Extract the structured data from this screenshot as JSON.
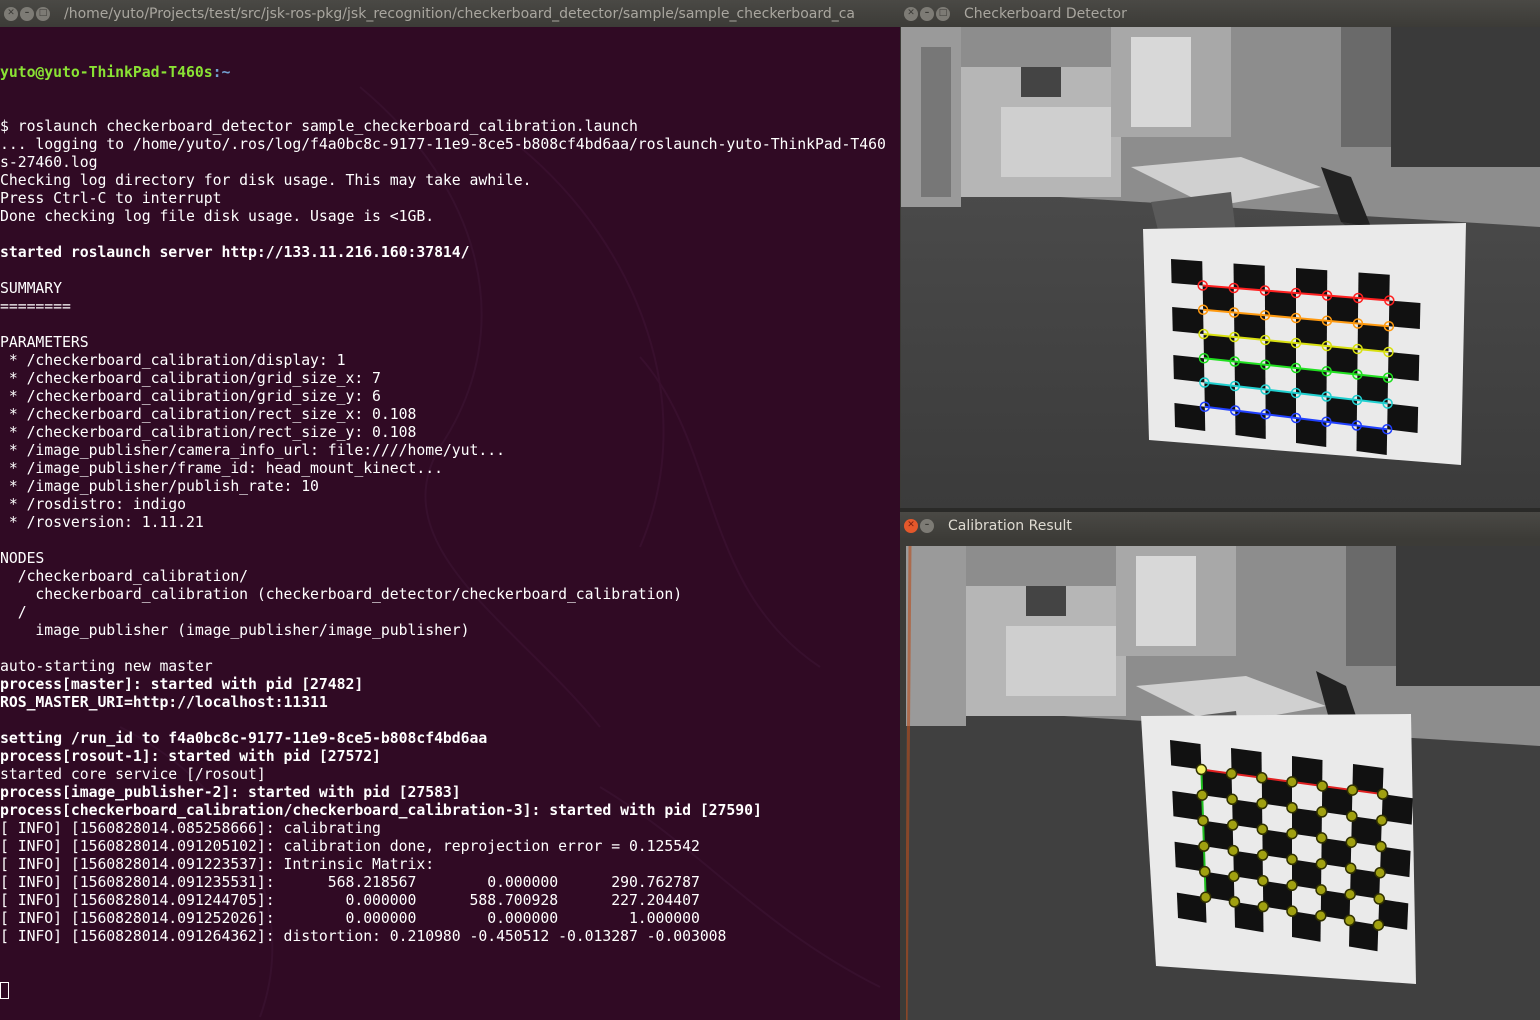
{
  "terminal": {
    "title": "/home/yuto/Projects/test/src/jsk-ros-pkg/jsk_recognition/checkerboard_detector/sample/sample_checkerboard_ca",
    "prompt_user": "yuto@yuto-ThinkPad-T460s",
    "prompt_path": ":~",
    "lines": [
      {
        "text": "$ roslaunch checkerboard_detector sample_checkerboard_calibration.launch",
        "bold": false
      },
      {
        "text": "... logging to /home/yuto/.ros/log/f4a0bc8c-9177-11e9-8ce5-b808cf4bd6aa/roslaunch-yuto-ThinkPad-T460",
        "bold": false
      },
      {
        "text": "s-27460.log",
        "bold": false
      },
      {
        "text": "Checking log directory for disk usage. This may take awhile.",
        "bold": false
      },
      {
        "text": "Press Ctrl-C to interrupt",
        "bold": false
      },
      {
        "text": "Done checking log file disk usage. Usage is <1GB.",
        "bold": false
      },
      {
        "text": "",
        "bold": false
      },
      {
        "text": "started roslaunch server http://133.11.216.160:37814/",
        "bold": true
      },
      {
        "text": "",
        "bold": false
      },
      {
        "text": "SUMMARY",
        "bold": false
      },
      {
        "text": "========",
        "bold": false
      },
      {
        "text": "",
        "bold": false
      },
      {
        "text": "PARAMETERS",
        "bold": false
      },
      {
        "text": " * /checkerboard_calibration/display: 1",
        "bold": false
      },
      {
        "text": " * /checkerboard_calibration/grid_size_x: 7",
        "bold": false
      },
      {
        "text": " * /checkerboard_calibration/grid_size_y: 6",
        "bold": false
      },
      {
        "text": " * /checkerboard_calibration/rect_size_x: 0.108",
        "bold": false
      },
      {
        "text": " * /checkerboard_calibration/rect_size_y: 0.108",
        "bold": false
      },
      {
        "text": " * /image_publisher/camera_info_url: file:////home/yut...",
        "bold": false
      },
      {
        "text": " * /image_publisher/frame_id: head_mount_kinect...",
        "bold": false
      },
      {
        "text": " * /image_publisher/publish_rate: 10",
        "bold": false
      },
      {
        "text": " * /rosdistro: indigo",
        "bold": false
      },
      {
        "text": " * /rosversion: 1.11.21",
        "bold": false
      },
      {
        "text": "",
        "bold": false
      },
      {
        "text": "NODES",
        "bold": false
      },
      {
        "text": "  /checkerboard_calibration/",
        "bold": false
      },
      {
        "text": "    checkerboard_calibration (checkerboard_detector/checkerboard_calibration)",
        "bold": false
      },
      {
        "text": "  /",
        "bold": false
      },
      {
        "text": "    image_publisher (image_publisher/image_publisher)",
        "bold": false
      },
      {
        "text": "",
        "bold": false
      },
      {
        "text": "auto-starting new master",
        "bold": false
      },
      {
        "text": "process[master]: started with pid [27482]",
        "bold": true
      },
      {
        "text": "ROS_MASTER_URI=http://localhost:11311",
        "bold": true
      },
      {
        "text": "",
        "bold": false
      },
      {
        "text": "setting /run_id to f4a0bc8c-9177-11e9-8ce5-b808cf4bd6aa",
        "bold": true
      },
      {
        "text": "process[rosout-1]: started with pid [27572]",
        "bold": true
      },
      {
        "text": "started core service [/rosout]",
        "bold": false
      },
      {
        "text": "process[image_publisher-2]: started with pid [27583]",
        "bold": true
      },
      {
        "text": "process[checkerboard_calibration/checkerboard_calibration-3]: started with pid [27590]",
        "bold": true
      },
      {
        "text": "[ INFO] [1560828014.085258666]: calibrating",
        "bold": false
      },
      {
        "text": "[ INFO] [1560828014.091205102]: calibration done, reprojection error = 0.125542",
        "bold": false
      },
      {
        "text": "[ INFO] [1560828014.091223537]: Intrinsic Matrix:",
        "bold": false
      },
      {
        "text": "[ INFO] [1560828014.091235531]:      568.218567        0.000000      290.762787",
        "bold": false
      },
      {
        "text": "[ INFO] [1560828014.091244705]:        0.000000      588.700928      227.204407",
        "bold": false
      },
      {
        "text": "[ INFO] [1560828014.091252026]:        0.000000        0.000000        1.000000",
        "bold": false
      },
      {
        "text": "[ INFO] [1560828014.091264362]: distortion: 0.210980 -0.450512 -0.013287 -0.003008",
        "bold": false
      }
    ]
  },
  "detector": {
    "title": "Checkerboard Detector"
  },
  "result": {
    "title": "Calibration Result"
  },
  "icons": {
    "close": "close-icon",
    "minimize": "minimize-icon",
    "maximize": "maximize-icon"
  },
  "colors": {
    "terminal_bg": "#300a24",
    "prompt_user": "#8ae234",
    "prompt_path": "#729fcf",
    "titlebar": "#3c3b37",
    "close_button": "#e4582b"
  }
}
